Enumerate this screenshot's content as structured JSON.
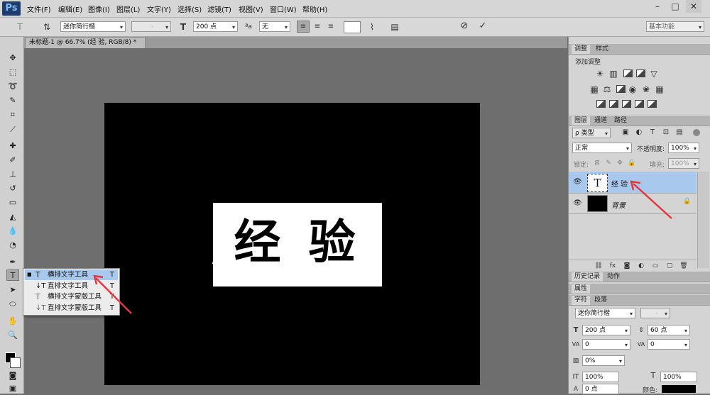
{
  "app": {
    "logo": "Ps"
  },
  "menu": [
    "文件(F)",
    "编辑(E)",
    "图像(I)",
    "图层(L)",
    "文字(Y)",
    "选择(S)",
    "滤镜(T)",
    "视图(V)",
    "窗口(W)",
    "帮助(H)"
  ],
  "window_controls": {
    "min": "–",
    "max": "□",
    "close": "✕"
  },
  "options": {
    "font_family": "迷你简行楷",
    "font_style": "-",
    "font_size": "200 点",
    "aa_label": "ªa",
    "antialias": "无",
    "workspace": "基本功能"
  },
  "doc_tab": "未标题-1 @ 66.7% (经 验, RGB/8) *",
  "canvas_text": "经 验",
  "flyout": [
    {
      "label": "横排文字工具",
      "key": "T",
      "selected": true
    },
    {
      "label": "直排文字工具",
      "key": "T",
      "selected": false
    },
    {
      "label": "横排文字蒙版工具",
      "key": "T",
      "selected": false
    },
    {
      "label": "直排文字蒙版工具",
      "key": "T",
      "selected": false
    }
  ],
  "panels": {
    "adjust_tabs": [
      "调整",
      "样式"
    ],
    "adjust_title": "添加调整",
    "layer_tabs": [
      "图层",
      "通道",
      "路径"
    ],
    "kind_label": "ρ 类型",
    "blend_mode": "正常",
    "opacity_label": "不透明度:",
    "opacity": "100%",
    "lock_label": "锁定:",
    "fill_label": "填充:",
    "fill": "100%",
    "layers": [
      {
        "name": "经 验",
        "type": "text",
        "selected": true
      },
      {
        "name": "背景",
        "type": "fill",
        "selected": false
      }
    ],
    "history_tabs": [
      "历史记录",
      "动作"
    ],
    "properties_label": "属性",
    "char_tabs": [
      "字符",
      "段落"
    ],
    "char_font": "迷你简行楷",
    "char_style": "-",
    "char_size": "200 点",
    "char_leading": "60 点",
    "char_kerning": "0",
    "char_tracking": "0",
    "char_shift": "0%",
    "char_vscale": "100%",
    "char_hscale": "100%",
    "char_color_label": "颜色:",
    "char_baseline": "0 点"
  },
  "colors": {
    "accent": "#e0393e",
    "selection": "#a9c8ee"
  }
}
